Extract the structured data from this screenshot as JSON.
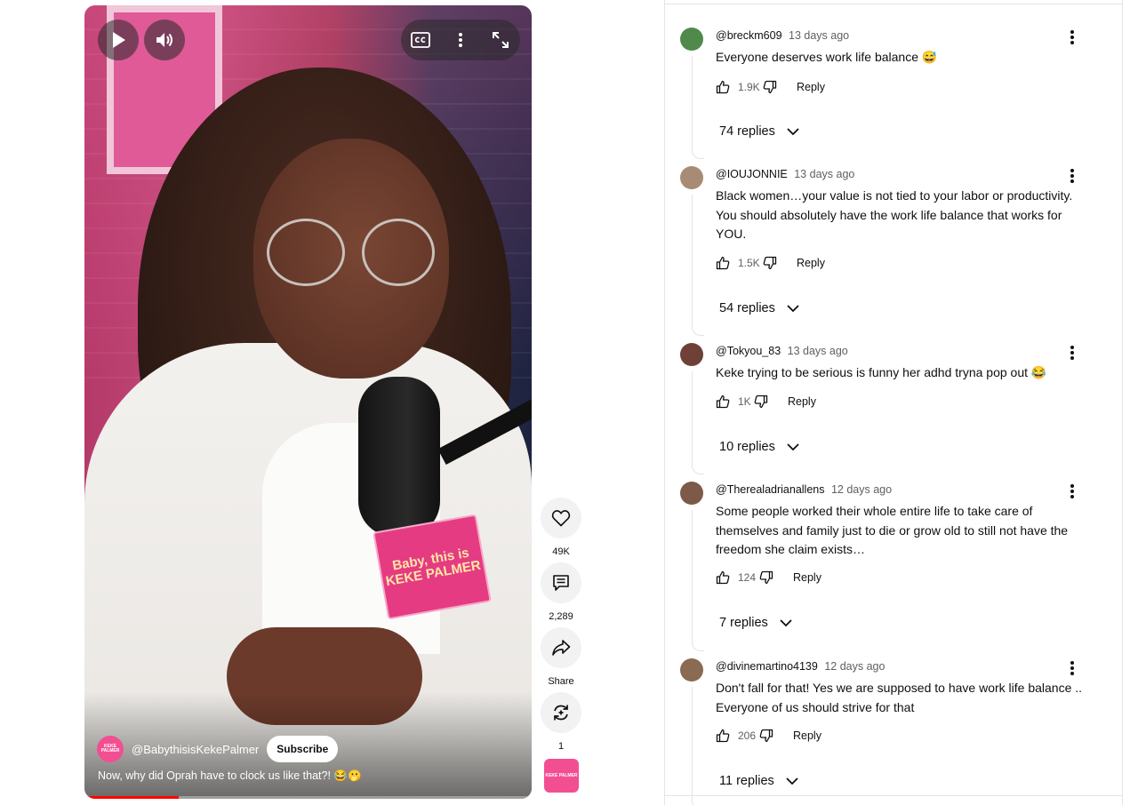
{
  "player": {
    "cube_text": "Baby, this is KEKE PALMER",
    "progress_fraction": 0.21,
    "channel": {
      "avatar_text": "KEKE PALMER",
      "name": "@BabythisisKekePalmer",
      "subscribe_label": "Subscribe"
    },
    "caption": "Now, why did Oprah have to clock us like that?! 😂🫢"
  },
  "actions": {
    "like_count": "49K",
    "comment_count": "2,289",
    "share_label": "Share",
    "remix_count": "1",
    "thumbnail_text": "KEKE PALMER"
  },
  "comments": [
    {
      "author": "@breckm609",
      "time": "13 days ago",
      "text": "Everyone deserves work life balance 😅",
      "likes": "1.9K",
      "reply_label": "Reply",
      "replies": "74 replies",
      "avatar_color": "#4f8a4a"
    },
    {
      "author": "@IOUJONNIE",
      "time": "13 days ago",
      "text": "Black women…your value is not tied to your labor or productivity. You should absolutely have the work life balance that works for YOU.",
      "likes": "1.5K",
      "reply_label": "Reply",
      "replies": "54 replies",
      "avatar_color": "#a78b74"
    },
    {
      "author": "@Tokyou_83",
      "time": "13 days ago",
      "text": "Keke trying to be serious is funny her adhd tryna pop out 😂",
      "likes": "1K",
      "reply_label": "Reply",
      "replies": "10 replies",
      "avatar_color": "#6e4036"
    },
    {
      "author": "@Therealadrianallens",
      "time": "12 days ago",
      "text": "Some people worked their whole entire life to take care of themselves and family just to die or grow old to still not have the freedom she claim exists…",
      "likes": "124",
      "reply_label": "Reply",
      "replies": "7 replies",
      "avatar_color": "#7d5a48"
    },
    {
      "author": "@divinemartino4139",
      "time": "12 days ago",
      "text": "Don't fall for that! Yes we are supposed to have work life balance .. Everyone of us should strive for that",
      "likes": "206",
      "reply_label": "Reply",
      "replies": "11 replies",
      "avatar_color": "#8a6a52"
    }
  ]
}
